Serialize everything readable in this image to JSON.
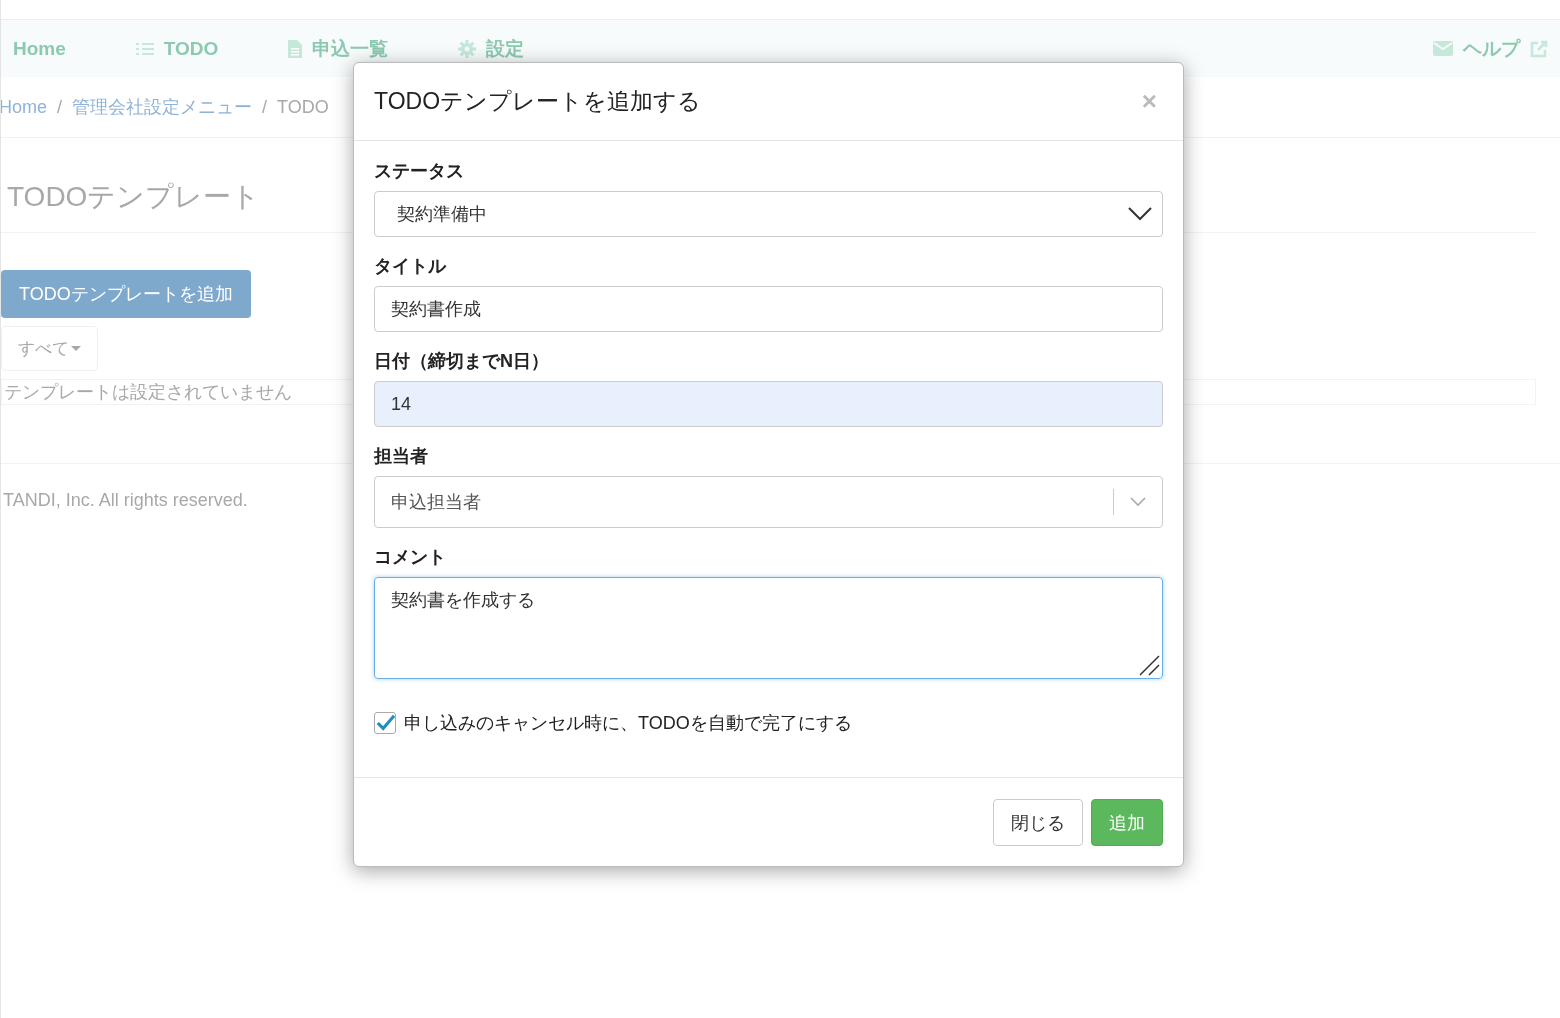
{
  "nav": {
    "items": [
      {
        "label": "Home",
        "kind": "plain"
      },
      {
        "label": "TODO",
        "kind": "list"
      },
      {
        "label": "申込一覧",
        "kind": "document"
      },
      {
        "label": "設定",
        "kind": "gear"
      }
    ],
    "help": "ヘルプ"
  },
  "breadcrumb_separator": "/",
  "breadcrumb": [
    {
      "label": "Home",
      "current": false
    },
    {
      "label": "管理会社設定メニュー",
      "current": false
    },
    {
      "label": "TODO",
      "current": true
    }
  ],
  "page_title": "TODOテンプレート",
  "add_button": "TODOテンプレートを追加",
  "filter": "すべて",
  "empty_message": "テンプレートは設定されていません",
  "footer": "TANDI, Inc. All rights reserved.",
  "modal": {
    "title": "TODOテンプレートを追加する",
    "close": "×",
    "fields": [
      {
        "label": "ステータス",
        "kind": "select",
        "value": "契約準備中",
        "focused": false,
        "autofilled": false
      },
      {
        "label": "タイトル",
        "kind": "text",
        "value": "契約書作成",
        "focused": false,
        "autofilled": false
      },
      {
        "label": "日付（締切までN日）",
        "kind": "text",
        "value": "14",
        "focused": false,
        "autofilled": true
      },
      {
        "label": "担当者",
        "kind": "combobox",
        "value": "申込担当者",
        "focused": false,
        "autofilled": false
      },
      {
        "label": "コメント",
        "kind": "textarea",
        "value": "契約書を作成する",
        "focused": true,
        "autofilled": false
      }
    ],
    "checkbox": {
      "label": "申し込みのキャンセル時に、TODOを自動で完了にする",
      "checked": true
    },
    "buttons": [
      {
        "label": "閉じる",
        "kind": "default"
      },
      {
        "label": "追加",
        "kind": "primary"
      }
    ]
  }
}
